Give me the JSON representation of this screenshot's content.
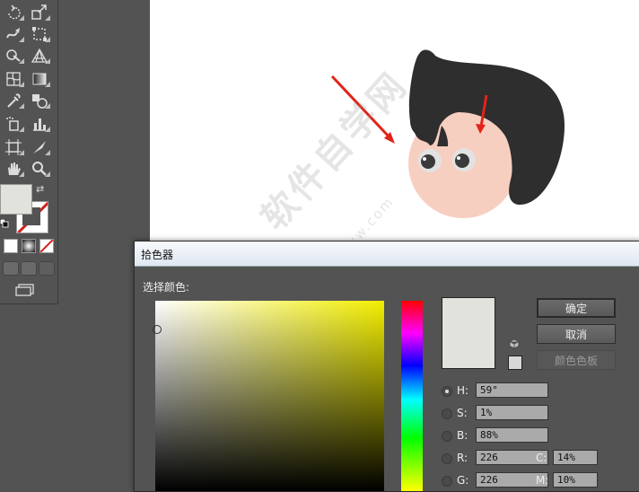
{
  "dialog": {
    "title": "拾色器",
    "subtitle": "选择颜色:",
    "buttons": {
      "ok": "确定",
      "cancel": "取消",
      "swatches": "颜色色板"
    },
    "fields": [
      {
        "label": "H:",
        "value": "59°",
        "selected": true
      },
      {
        "label": "S:",
        "value": "1%",
        "selected": false
      },
      {
        "label": "B:",
        "value": "88%",
        "selected": false
      },
      {
        "label": "R:",
        "value": "226",
        "selected": false
      },
      {
        "label": "G:",
        "value": "226",
        "selected": false
      }
    ],
    "cmyk": [
      {
        "label": "C:",
        "value": "14%"
      },
      {
        "label": "M:",
        "value": "10%"
      }
    ],
    "preview_color": "#e2e2dd"
  },
  "watermark": {
    "text": "软件自学网",
    "url": "www.rjzxw.com"
  },
  "toolbar": {
    "fill_color": "#e2e2dd",
    "stroke": "none",
    "tools": [
      "rotate-icon",
      "scale-icon",
      "warp-icon",
      "free-transform-icon",
      "shape-builder-icon",
      "perspective-grid-icon",
      "mesh-icon",
      "gradient-icon",
      "eyedropper-icon",
      "blend-icon",
      "symbol-sprayer-icon",
      "column-graph-icon",
      "artboard-icon",
      "slice-icon",
      "hand-icon",
      "zoom-icon"
    ]
  }
}
